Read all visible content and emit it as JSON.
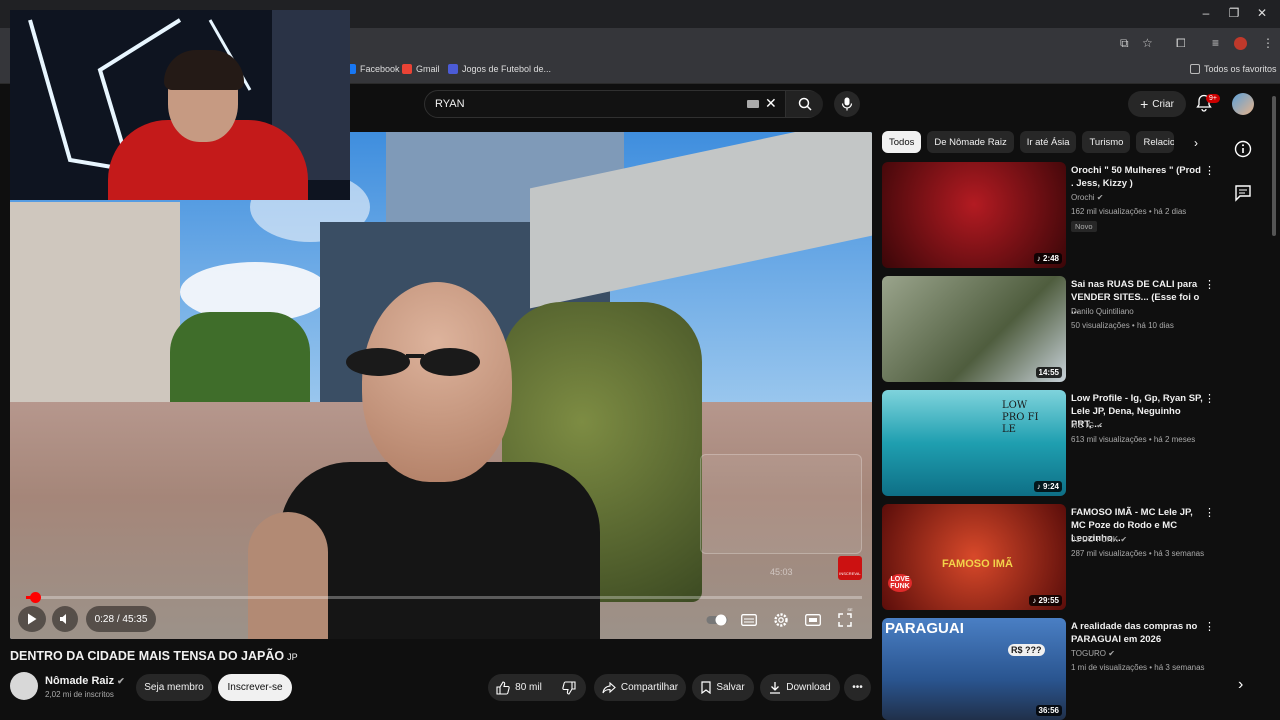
{
  "browser": {
    "window_controls": [
      "–",
      "❐",
      "✕"
    ],
    "bookmarks": [
      {
        "label": "Facebook",
        "color": "#1877f2"
      },
      {
        "label": "Gmail",
        "color": "#ea4335"
      },
      {
        "label": "Jogos de Futebol de...",
        "color": "#4b5bd6"
      }
    ],
    "all_bookmarks_label": "Todos os favoritos"
  },
  "youtube": {
    "search": {
      "query": "RYAN"
    },
    "create_label": "Criar",
    "notif_badge": "9+"
  },
  "player": {
    "time_display": "0:28 / 45:35",
    "progress": 0.0102,
    "end_card_time": "45:03",
    "end_card_label": "INSCREVA-SE"
  },
  "video": {
    "title": "DENTRO DA CIDADE MAIS TENSA DO JAPÃO",
    "title_flag": "JP",
    "channel_name": "Nômade Raiz",
    "subscribers": "2,02 mi de inscritos",
    "join_label": "Seja membro",
    "subscribe_label": "Inscrever-se",
    "likes": "80 mil",
    "share_label": "Compartilhar",
    "save_label": "Salvar",
    "download_label": "Download"
  },
  "chips": [
    "Todos",
    "De Nômade Raiz",
    "Ir até Ásia",
    "Turismo",
    "Relacion"
  ],
  "recommendations": [
    {
      "title": "Orochi \" 50 Mulheres \" (Prod . Jess, Kizzy )",
      "channel": "Orochi",
      "meta": "162 mil visualizações • há 2 dias",
      "badge": "Novo",
      "duration": "♪ 2:48",
      "thumb_color": "#7a1014"
    },
    {
      "title": "Sai nas RUAS DE CALI para VENDER SITES... (Esse foi o ...",
      "channel": "Danilo Quintiliano",
      "meta": "50 visualizações • há 10 dias",
      "badge": "",
      "duration": "14:55",
      "thumb_color": "#6c7a5a"
    },
    {
      "title": "Low Profile - Ig, Gp, Ryan SP, Lele JP, Dena, Neguinho PRT, ...",
      "channel": "MC IG",
      "meta": "613 mil visualizações • há 2 meses",
      "badge": "",
      "duration": "♪ 9:24",
      "thumb_color": "#2bb6c6"
    },
    {
      "title": "FAMOSO IMÃ - MC Lele JP, MC Poze do Rodo e MC Leozinho...",
      "channel": "01 DO FUNK",
      "meta": "287 mil visualizações • há 3 semanas",
      "badge": "",
      "duration": "♪ 29:55",
      "thumb_color": "#b2241c"
    },
    {
      "title": "A realidade das compras no PARAGUAI em 2026",
      "channel": "TOGURO",
      "meta": "1 mi de visualizações • há 3 semanas",
      "badge": "",
      "duration": "36:56",
      "thumb_color": "#2d6ab0"
    }
  ],
  "thumb_texts": {
    "paraguai": "PARAGUAI",
    "rs": "R$ ???",
    "low_profile": "LOW PRO FI LE",
    "famoso": "FAMOSO IMÃ",
    "love_funk": "LOVE FUNK"
  }
}
